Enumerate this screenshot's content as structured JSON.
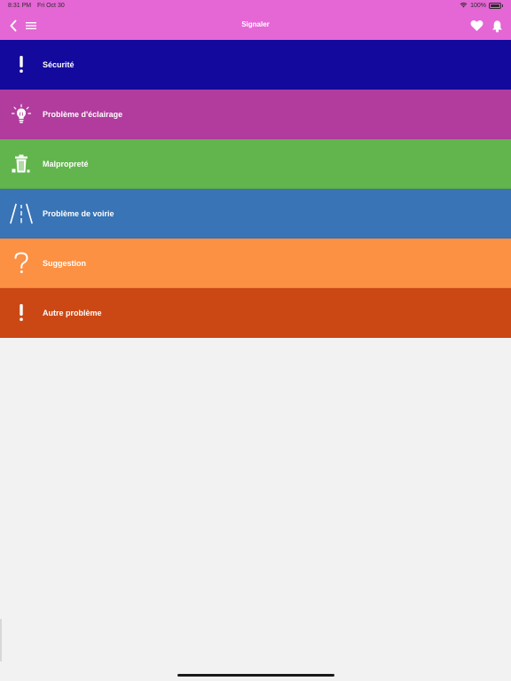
{
  "status_bar": {
    "time": "8:31 PM",
    "date": "Fri Oct 30",
    "battery": "100%"
  },
  "header": {
    "title": "Signaler",
    "color": "#e566d5"
  },
  "categories": [
    {
      "label": "Sécurité",
      "icon": "exclamation-icon",
      "color": "#13099d"
    },
    {
      "label": "Problème d'éclairage",
      "icon": "lightbulb-icon",
      "color": "#b13c9d"
    },
    {
      "label": "Malpropreté",
      "icon": "trash-icon",
      "color": "#62b54c"
    },
    {
      "label": "Problème de voirie",
      "icon": "road-icon",
      "color": "#3874b6"
    },
    {
      "label": "Suggestion",
      "icon": "question-icon",
      "color": "#fc9043"
    },
    {
      "label": "Autre problème",
      "icon": "exclamation-icon",
      "color": "#cb4815"
    }
  ]
}
